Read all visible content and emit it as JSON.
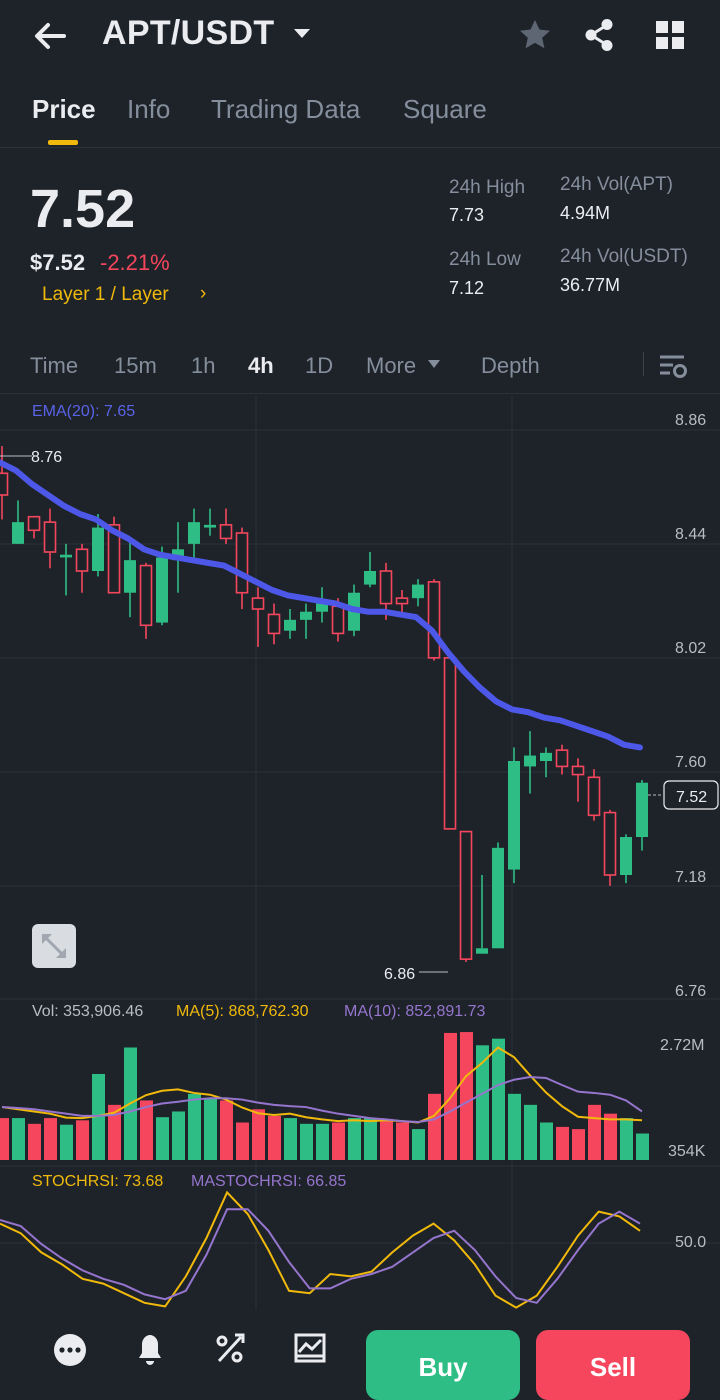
{
  "header": {
    "pair": "APT/USDT"
  },
  "tabs": [
    {
      "label": "Price",
      "active": true
    },
    {
      "label": "Info"
    },
    {
      "label": "Trading Data"
    },
    {
      "label": "Square"
    }
  ],
  "ticker": {
    "price": "7.52",
    "price_usd": "$7.52",
    "change": "-2.21%",
    "category": "Layer 1 / Layer",
    "high_label": "24h High",
    "high": "7.73",
    "low_label": "24h Low",
    "low": "7.12",
    "vol_apt_label": "24h Vol(APT)",
    "vol_apt": "4.94M",
    "vol_usdt_label": "24h Vol(USDT)",
    "vol_usdt": "36.77M"
  },
  "intervals": [
    {
      "label": "Time"
    },
    {
      "label": "15m"
    },
    {
      "label": "1h"
    },
    {
      "label": "4h",
      "active": true
    },
    {
      "label": "1D"
    },
    {
      "label": "More"
    },
    {
      "label": "Depth"
    }
  ],
  "chart_data": [
    {
      "type": "candlestick",
      "indicator": "EMA(20): 7.65",
      "y_ticks": [
        "8.86",
        "8.44",
        "8.02",
        "7.60",
        "7.18",
        "6.76"
      ],
      "ylim": [
        6.76,
        8.86
      ],
      "last_price_label": "7.52",
      "max_label": "8.76",
      "min_label": "6.86",
      "candles": [
        [
          8.66,
          8.58,
          8.76,
          8.49
        ],
        [
          8.4,
          8.48,
          8.56,
          8.4
        ],
        [
          8.5,
          8.45,
          8.5,
          8.42
        ],
        [
          8.48,
          8.37,
          8.53,
          8.31
        ],
        [
          8.35,
          8.36,
          8.4,
          8.21
        ],
        [
          8.38,
          8.3,
          8.4,
          8.22
        ],
        [
          8.3,
          8.46,
          8.51,
          8.28
        ],
        [
          8.47,
          8.22,
          8.5,
          8.22
        ],
        [
          8.22,
          8.34,
          8.41,
          8.13
        ],
        [
          8.32,
          8.1,
          8.33,
          8.05
        ],
        [
          8.11,
          8.35,
          8.39,
          8.1
        ],
        [
          8.34,
          8.38,
          8.48,
          8.22
        ],
        [
          8.4,
          8.48,
          8.53,
          8.35
        ],
        [
          8.46,
          8.47,
          8.53,
          8.43
        ],
        [
          8.47,
          8.42,
          8.53,
          8.4
        ],
        [
          8.44,
          8.22,
          8.46,
          8.16
        ],
        [
          8.2,
          8.16,
          8.24,
          8.02
        ],
        [
          8.14,
          8.07,
          8.18,
          8.03
        ],
        [
          8.08,
          8.12,
          8.16,
          8.05
        ],
        [
          8.12,
          8.15,
          8.18,
          8.05
        ],
        [
          8.15,
          8.18,
          8.24,
          8.11
        ],
        [
          8.17,
          8.07,
          8.2,
          8.04
        ],
        [
          8.08,
          8.22,
          8.25,
          8.06
        ],
        [
          8.25,
          8.3,
          8.37,
          8.24
        ],
        [
          8.3,
          8.18,
          8.33,
          8.12
        ],
        [
          8.2,
          8.18,
          8.23,
          8.14
        ],
        [
          8.2,
          8.25,
          8.27,
          8.17
        ],
        [
          8.26,
          7.98,
          8.27,
          7.97
        ],
        [
          7.98,
          7.35,
          8.0,
          7.35
        ],
        [
          7.34,
          6.87,
          7.34,
          6.86
        ],
        [
          6.89,
          6.91,
          7.18,
          6.91
        ],
        [
          6.91,
          7.28,
          7.3,
          6.93
        ],
        [
          7.2,
          7.6,
          7.65,
          7.15
        ],
        [
          7.58,
          7.62,
          7.71,
          7.48
        ],
        [
          7.6,
          7.63,
          7.65,
          7.54
        ],
        [
          7.64,
          7.58,
          7.66,
          7.55
        ],
        [
          7.58,
          7.55,
          7.61,
          7.45
        ],
        [
          7.54,
          7.4,
          7.57,
          7.38
        ],
        [
          7.41,
          7.18,
          7.42,
          7.14
        ],
        [
          7.18,
          7.32,
          7.33,
          7.15
        ],
        [
          7.32,
          7.52,
          7.53,
          7.27
        ]
      ],
      "ema": [
        8.7,
        8.67,
        8.62,
        8.58,
        8.54,
        8.51,
        8.49,
        8.45,
        8.42,
        8.38,
        8.36,
        8.35,
        8.34,
        8.33,
        8.32,
        8.29,
        8.26,
        8.23,
        8.21,
        8.2,
        8.19,
        8.18,
        8.16,
        8.15,
        8.15,
        8.14,
        8.13,
        8.08,
        8.0,
        7.93,
        7.87,
        7.82,
        7.79,
        7.78,
        7.76,
        7.75,
        7.73,
        7.71,
        7.69,
        7.66,
        7.65
      ]
    },
    {
      "type": "bar",
      "title": "Vol: 353,906.46",
      "ma5_label": "MA(5): 868,762.30",
      "ma10_label": "MA(10): 852,891.73",
      "y_ticks": [
        "2.72M",
        "354K"
      ],
      "ylim": [
        0.354,
        2.72
      ],
      "values": [
        0.95,
        0.95,
        0.82,
        0.95,
        0.8,
        0.9,
        1.95,
        1.25,
        2.55,
        1.35,
        0.97,
        1.1,
        1.5,
        1.4,
        1.35,
        0.85,
        1.15,
        1.0,
        0.95,
        0.82,
        0.82,
        0.85,
        0.95,
        0.95,
        0.93,
        0.85,
        0.7,
        1.5,
        2.88,
        2.9,
        2.6,
        2.75,
        1.5,
        1.25,
        0.85,
        0.75,
        0.7,
        1.25,
        1.05,
        0.95,
        0.6
      ],
      "ma5": [
        1.2,
        1.15,
        1.1,
        1.05,
        0.96,
        0.95,
        1.0,
        1.07,
        1.28,
        1.47,
        1.57,
        1.6,
        1.52,
        1.48,
        1.37,
        1.19,
        1.06,
        1.02,
        1.05,
        0.97,
        0.92,
        0.88,
        0.9,
        0.88,
        0.9,
        0.88,
        0.85,
        1.0,
        1.4,
        1.9,
        2.2,
        2.55,
        2.33,
        1.92,
        1.53,
        1.22,
        0.98,
        0.95,
        0.92,
        0.92,
        0.9
      ],
      "ma10": [
        1.2,
        1.18,
        1.15,
        1.1,
        1.05,
        1.0,
        1.0,
        1.02,
        1.1,
        1.2,
        1.28,
        1.32,
        1.37,
        1.4,
        1.4,
        1.37,
        1.3,
        1.25,
        1.22,
        1.2,
        1.12,
        1.05,
        1.0,
        0.95,
        0.92,
        0.88,
        0.86,
        0.92,
        1.1,
        1.3,
        1.5,
        1.7,
        1.82,
        1.88,
        1.86,
        1.7,
        1.55,
        1.52,
        1.48,
        1.35,
        1.1
      ]
    },
    {
      "type": "line",
      "title": "STOCHRSI: 73.68",
      "ma_label": "MASTOCHRSI: 66.85",
      "y_ticks": [
        "50.0"
      ],
      "ylim": [
        0,
        100
      ],
      "stochrsi": [
        72,
        64,
        48,
        38,
        26,
        22,
        14,
        6,
        3,
        28,
        60,
        98,
        80,
        50,
        16,
        14,
        30,
        28,
        32,
        48,
        62,
        72,
        58,
        38,
        12,
        2,
        12,
        36,
        62,
        82,
        78,
        66
      ],
      "mastochrsi": [
        75,
        70,
        55,
        43,
        33,
        26,
        21,
        13,
        9,
        16,
        46,
        84,
        84,
        66,
        40,
        18,
        18,
        26,
        30,
        36,
        48,
        60,
        66,
        50,
        28,
        10,
        6,
        26,
        50,
        72,
        82,
        72
      ]
    }
  ],
  "bottom": {
    "buy_label": "Buy",
    "sell_label": "Sell"
  },
  "colors": {
    "up": "#2ebd85",
    "down": "#f6465d",
    "ema": "#4d58e8",
    "ma5": "#f0b90b",
    "ma10": "#9575cd",
    "accent": "#f0b90b"
  }
}
